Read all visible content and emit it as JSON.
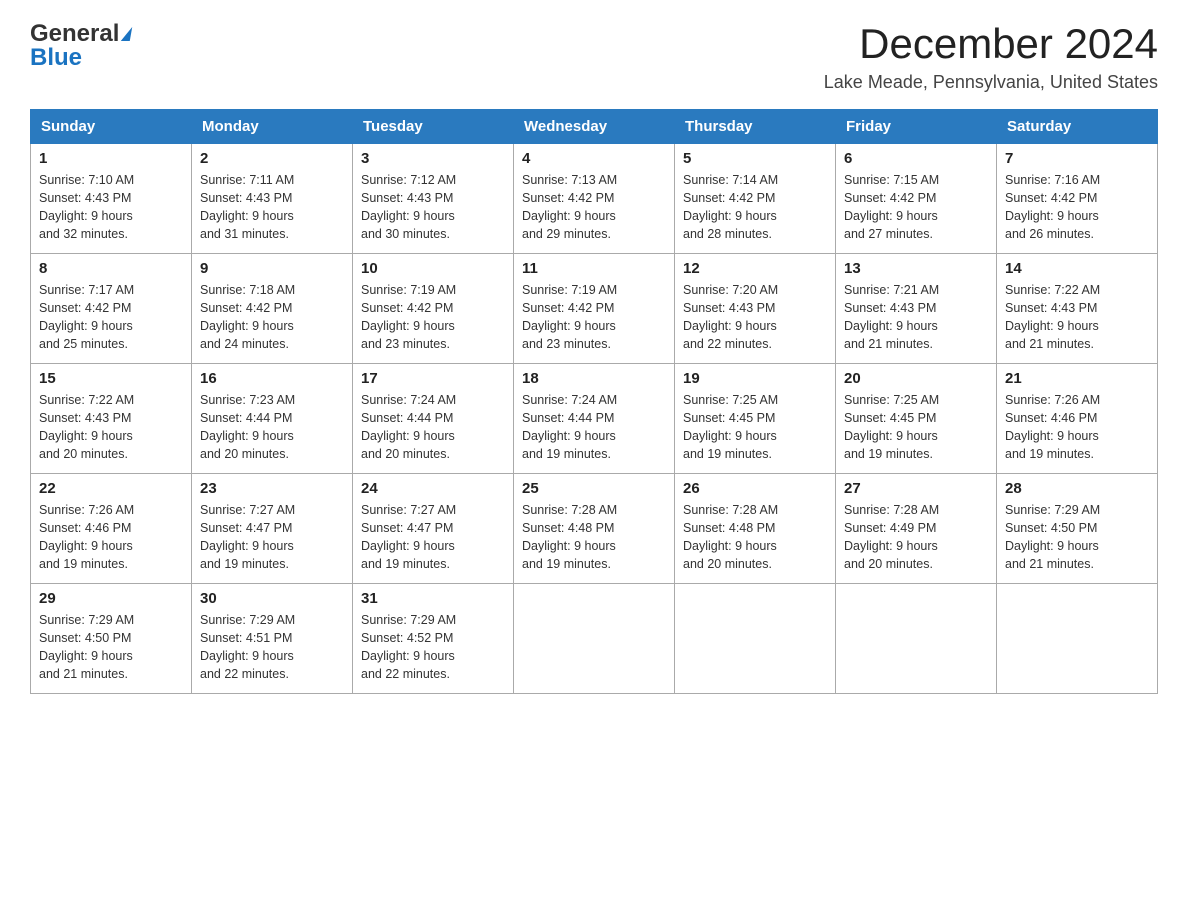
{
  "header": {
    "logo_general": "General",
    "logo_blue": "Blue",
    "month_title": "December 2024",
    "location": "Lake Meade, Pennsylvania, United States"
  },
  "days_of_week": [
    "Sunday",
    "Monday",
    "Tuesday",
    "Wednesday",
    "Thursday",
    "Friday",
    "Saturday"
  ],
  "weeks": [
    [
      {
        "day": "1",
        "sunrise": "7:10 AM",
        "sunset": "4:43 PM",
        "daylight": "9 hours and 32 minutes."
      },
      {
        "day": "2",
        "sunrise": "7:11 AM",
        "sunset": "4:43 PM",
        "daylight": "9 hours and 31 minutes."
      },
      {
        "day": "3",
        "sunrise": "7:12 AM",
        "sunset": "4:43 PM",
        "daylight": "9 hours and 30 minutes."
      },
      {
        "day": "4",
        "sunrise": "7:13 AM",
        "sunset": "4:42 PM",
        "daylight": "9 hours and 29 minutes."
      },
      {
        "day": "5",
        "sunrise": "7:14 AM",
        "sunset": "4:42 PM",
        "daylight": "9 hours and 28 minutes."
      },
      {
        "day": "6",
        "sunrise": "7:15 AM",
        "sunset": "4:42 PM",
        "daylight": "9 hours and 27 minutes."
      },
      {
        "day": "7",
        "sunrise": "7:16 AM",
        "sunset": "4:42 PM",
        "daylight": "9 hours and 26 minutes."
      }
    ],
    [
      {
        "day": "8",
        "sunrise": "7:17 AM",
        "sunset": "4:42 PM",
        "daylight": "9 hours and 25 minutes."
      },
      {
        "day": "9",
        "sunrise": "7:18 AM",
        "sunset": "4:42 PM",
        "daylight": "9 hours and 24 minutes."
      },
      {
        "day": "10",
        "sunrise": "7:19 AM",
        "sunset": "4:42 PM",
        "daylight": "9 hours and 23 minutes."
      },
      {
        "day": "11",
        "sunrise": "7:19 AM",
        "sunset": "4:42 PM",
        "daylight": "9 hours and 23 minutes."
      },
      {
        "day": "12",
        "sunrise": "7:20 AM",
        "sunset": "4:43 PM",
        "daylight": "9 hours and 22 minutes."
      },
      {
        "day": "13",
        "sunrise": "7:21 AM",
        "sunset": "4:43 PM",
        "daylight": "9 hours and 21 minutes."
      },
      {
        "day": "14",
        "sunrise": "7:22 AM",
        "sunset": "4:43 PM",
        "daylight": "9 hours and 21 minutes."
      }
    ],
    [
      {
        "day": "15",
        "sunrise": "7:22 AM",
        "sunset": "4:43 PM",
        "daylight": "9 hours and 20 minutes."
      },
      {
        "day": "16",
        "sunrise": "7:23 AM",
        "sunset": "4:44 PM",
        "daylight": "9 hours and 20 minutes."
      },
      {
        "day": "17",
        "sunrise": "7:24 AM",
        "sunset": "4:44 PM",
        "daylight": "9 hours and 20 minutes."
      },
      {
        "day": "18",
        "sunrise": "7:24 AM",
        "sunset": "4:44 PM",
        "daylight": "9 hours and 19 minutes."
      },
      {
        "day": "19",
        "sunrise": "7:25 AM",
        "sunset": "4:45 PM",
        "daylight": "9 hours and 19 minutes."
      },
      {
        "day": "20",
        "sunrise": "7:25 AM",
        "sunset": "4:45 PM",
        "daylight": "9 hours and 19 minutes."
      },
      {
        "day": "21",
        "sunrise": "7:26 AM",
        "sunset": "4:46 PM",
        "daylight": "9 hours and 19 minutes."
      }
    ],
    [
      {
        "day": "22",
        "sunrise": "7:26 AM",
        "sunset": "4:46 PM",
        "daylight": "9 hours and 19 minutes."
      },
      {
        "day": "23",
        "sunrise": "7:27 AM",
        "sunset": "4:47 PM",
        "daylight": "9 hours and 19 minutes."
      },
      {
        "day": "24",
        "sunrise": "7:27 AM",
        "sunset": "4:47 PM",
        "daylight": "9 hours and 19 minutes."
      },
      {
        "day": "25",
        "sunrise": "7:28 AM",
        "sunset": "4:48 PM",
        "daylight": "9 hours and 19 minutes."
      },
      {
        "day": "26",
        "sunrise": "7:28 AM",
        "sunset": "4:48 PM",
        "daylight": "9 hours and 20 minutes."
      },
      {
        "day": "27",
        "sunrise": "7:28 AM",
        "sunset": "4:49 PM",
        "daylight": "9 hours and 20 minutes."
      },
      {
        "day": "28",
        "sunrise": "7:29 AM",
        "sunset": "4:50 PM",
        "daylight": "9 hours and 21 minutes."
      }
    ],
    [
      {
        "day": "29",
        "sunrise": "7:29 AM",
        "sunset": "4:50 PM",
        "daylight": "9 hours and 21 minutes."
      },
      {
        "day": "30",
        "sunrise": "7:29 AM",
        "sunset": "4:51 PM",
        "daylight": "9 hours and 22 minutes."
      },
      {
        "day": "31",
        "sunrise": "7:29 AM",
        "sunset": "4:52 PM",
        "daylight": "9 hours and 22 minutes."
      },
      null,
      null,
      null,
      null
    ]
  ],
  "labels": {
    "sunrise": "Sunrise:",
    "sunset": "Sunset:",
    "daylight": "Daylight:"
  }
}
